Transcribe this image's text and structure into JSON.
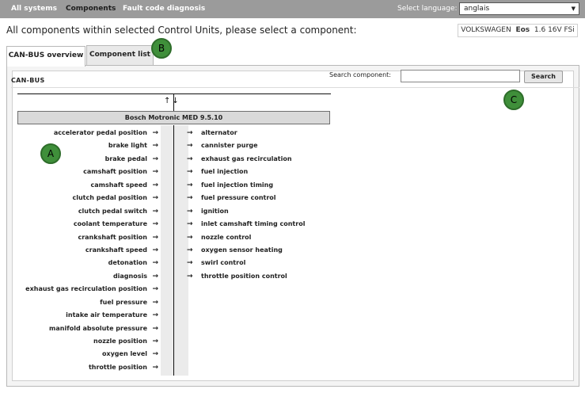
{
  "topnav": {
    "items": [
      "All systems",
      "Components",
      "Fault code diagnosis"
    ],
    "active_index": 1,
    "language_label": "Select language:",
    "language_value": "anglais"
  },
  "heading": "All components within selected Control Units, please select a component:",
  "vehicle": {
    "make": "VOLKSWAGEN",
    "model": "Eos",
    "engine": "1.6 16V FSi"
  },
  "tabs": [
    {
      "label": "CAN-BUS overview",
      "active": true
    },
    {
      "label": "Component list",
      "active": false
    }
  ],
  "panel": {
    "title": "CAN-BUS",
    "search_label": "Search component:",
    "search_value": "",
    "search_button": "Search"
  },
  "diagram": {
    "bus_arrows": "↑↓",
    "ecu": "Bosch Motronic MED 9.5.10",
    "arrow": "→",
    "inputs": [
      "accelerator pedal position",
      "brake light",
      "brake pedal",
      "camshaft position",
      "camshaft speed",
      "clutch pedal position",
      "clutch pedal switch",
      "coolant temperature",
      "crankshaft position",
      "crankshaft speed",
      "detonation",
      "diagnosis",
      "exhaust gas recirculation position",
      "fuel pressure",
      "intake air temperature",
      "manifold absolute pressure",
      "nozzle position",
      "oxygen level",
      "throttle position"
    ],
    "outputs": [
      "alternator",
      "cannister purge",
      "exhaust gas recirculation",
      "fuel injection",
      "fuel injection timing",
      "fuel pressure control",
      "ignition",
      "inlet camshaft timing control",
      "nozzle control",
      "oxygen sensor heating",
      "swirl control",
      "throttle position control"
    ]
  },
  "callouts": {
    "a": "A",
    "b": "B",
    "c": "C"
  },
  "colors": {
    "topbar": "#9b9b9b",
    "callout": "#3f8f3a",
    "ecu_box": "#d9d9d9"
  }
}
